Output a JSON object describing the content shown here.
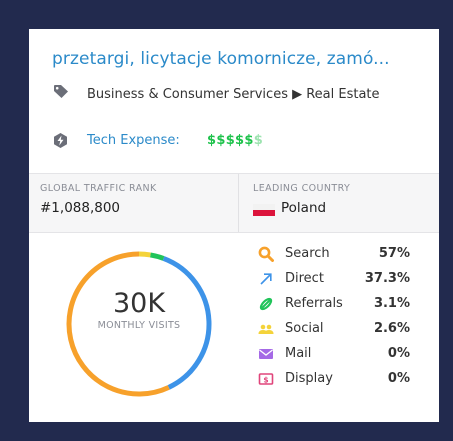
{
  "site": {
    "title": "przetargi, licytacje komornicze, zamó...",
    "category": "Business & Consumer Services ▶ Real Estate",
    "tech_expense_label": "Tech Expense:",
    "tech_expense_on": "$$$$$",
    "tech_expense_off": "$"
  },
  "stats": {
    "global_rank_label": "GLOBAL TRAFFIC RANK",
    "global_rank_value": "#1,088,800",
    "leading_country_label": "LEADING COUNTRY",
    "leading_country_value": "Poland"
  },
  "visits": {
    "value": "30K",
    "label": "MONTHLY VISITS"
  },
  "sources": [
    {
      "icon": "search-icon",
      "label": "Search",
      "value": "57%",
      "share": 57,
      "color": "#f7a12b"
    },
    {
      "icon": "direct-arrow-icon",
      "label": "Direct",
      "value": "37.3%",
      "share": 37.3,
      "color": "#3d93e8"
    },
    {
      "icon": "referrals-link-icon",
      "label": "Referrals",
      "value": "3.1%",
      "share": 3.1,
      "color": "#21c45a"
    },
    {
      "icon": "social-people-icon",
      "label": "Social",
      "value": "2.6%",
      "share": 2.6,
      "color": "#f4d33a"
    },
    {
      "icon": "mail-icon",
      "label": "Mail",
      "value": "0%",
      "share": 0,
      "color": "#a569e6"
    },
    {
      "icon": "display-ad-icon",
      "label": "Display",
      "value": "0%",
      "share": 0,
      "color": "#e0457b"
    }
  ],
  "colors": {
    "background": "#222a4e",
    "accent": "#2b8ac9",
    "money": "#1ec24c"
  }
}
